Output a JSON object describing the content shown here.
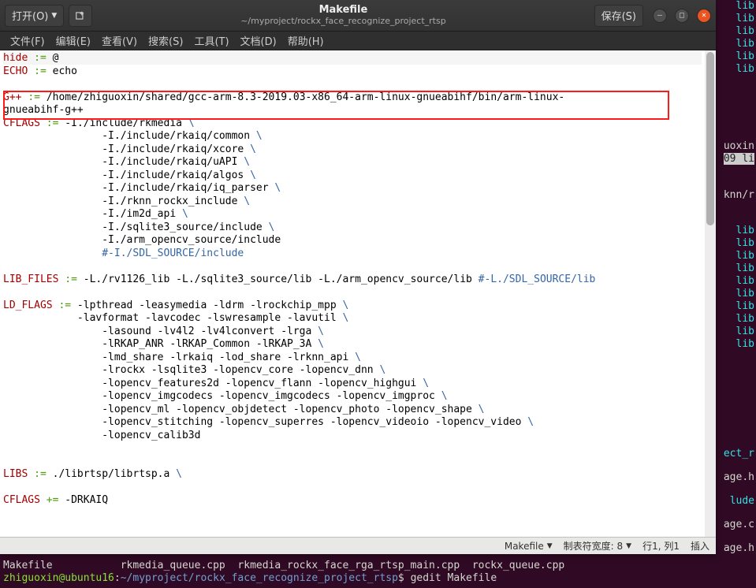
{
  "header": {
    "open_label": "打开(O)",
    "save_label": "保存(S)",
    "title": "Makefile",
    "subtitle": "~/myproject/rockx_face_recognize_project_rtsp"
  },
  "menu": {
    "file": "文件(F)",
    "edit": "编辑(E)",
    "view": "查看(V)",
    "search": "搜索(S)",
    "tools": "工具(T)",
    "documents": "文档(D)",
    "help": "帮助(H)"
  },
  "status": {
    "filetype": "Makefile",
    "tabwidth_label": "制表符宽度: 8",
    "position": "行1, 列1",
    "insert_mode": "插入"
  },
  "terminal": {
    "lines_top": [
      "lib",
      "lib",
      "lib",
      "lib",
      "lib",
      "lib"
    ],
    "uoxin": "uoxin",
    "line09": "09 li",
    "knn": "knn/r",
    "libs_block": [
      "lib",
      "lib",
      "lib",
      "lib",
      "lib",
      "lib",
      "lib",
      "lib",
      "lib",
      "lib"
    ],
    "ect_r": "ect_r",
    "age_h": "age.h",
    "lude": "lude",
    "age_c": "age.c",
    "age_h2": "age.h",
    "bottom1_a": "Makefile           rkmedia_queue.cpp  rkmedia_rockx_face_rga_rtsp_main.cpp  rockx_queue.cpp",
    "prompt_user": "zhiguoxin@ubuntu16",
    "prompt_sep": ":",
    "prompt_path": "~/myproject/rockx_face_recognize_project_rtsp",
    "prompt_cmd": "$ gedit Makefile"
  },
  "editor": {
    "l1a": "hide ",
    "l1b": ":=",
    "l1c": " @",
    "l2a": "ECHO ",
    "l2b": ":=",
    "l2c": " echo",
    "l3": "",
    "l4a": "G++ ",
    "l4b": ":=",
    "l4c": " /home/zhiguoxin/shared/gcc-arm-8.3-2019.03-x86_64-arm-linux-gnueabihf/bin/arm-linux-",
    "l5": "gnueabihf-g++",
    "l6a": "CFLAGS ",
    "l6b": ":=",
    "l6c": " -I./include/rkmedia ",
    "l6d": "\\",
    "l7a": "                -I./include/rkaiq/common ",
    "l7b": "\\",
    "l8a": "                -I./include/rkaiq/xcore ",
    "l8b": "\\",
    "l9a": "                -I./include/rkaiq/uAPI ",
    "l9b": "\\",
    "l10a": "                -I./include/rkaiq/algos ",
    "l10b": "\\",
    "l11a": "                -I./include/rkaiq/iq_parser ",
    "l11b": "\\",
    "l12a": "                -I./rknn_rockx_include ",
    "l12b": "\\",
    "l13a": "                -I./im2d_api ",
    "l13b": "\\",
    "l14a": "                -I./sqlite3_source/include ",
    "l14b": "\\",
    "l15a": "                -I./arm_opencv_source/include",
    "l16a": "                ",
    "l16b": "#-I./SDL_SOURCE/include",
    "l17": "",
    "l18a": "LIB_FILES ",
    "l18b": ":=",
    "l18c": " -L./rv1126_lib -L./sqlite3_source/lib -L./arm_opencv_source/lib ",
    "l18d": "#-L./SDL_SOURCE/lib",
    "l19": "",
    "l20a": "LD_FLAGS ",
    "l20b": ":=",
    "l20c": " -lpthread -leasymedia -ldrm -lrockchip_mpp ",
    "l20d": "\\",
    "l21a": "            -lavformat -lavcodec -lswresample -lavutil ",
    "l21b": "\\",
    "l22a": "                -lasound -lv4l2 -lv4lconvert -lrga ",
    "l22b": "\\",
    "l23a": "                -lRKAP_ANR -lRKAP_Common -lRKAP_3A ",
    "l23b": "\\",
    "l24a": "                -lmd_share -lrkaiq -lod_share -lrknn_api ",
    "l24b": "\\",
    "l25a": "                -lrockx -lsqlite3 -lopencv_core -lopencv_dnn ",
    "l25b": "\\",
    "l26a": "                -lopencv_features2d -lopencv_flann -lopencv_highgui ",
    "l26b": "\\",
    "l27a": "                -lopencv_imgcodecs -lopencv_imgcodecs -lopencv_imgproc ",
    "l27b": "\\",
    "l28a": "                -lopencv_ml -lopencv_objdetect -lopencv_photo -lopencv_shape ",
    "l28b": "\\",
    "l29a": "                -lopencv_stitching -lopencv_superres -lopencv_videoio -lopencv_video ",
    "l29b": "\\",
    "l30a": "                -lopencv_calib3d",
    "l31": "",
    "l32": "",
    "l33a": "LIBS ",
    "l33b": ":=",
    "l33c": " ./librtsp/librtsp.a ",
    "l33d": "\\",
    "l34": "",
    "l35a": "CFLAGS ",
    "l35b": "+=",
    "l35c": " -DRKAIQ"
  }
}
